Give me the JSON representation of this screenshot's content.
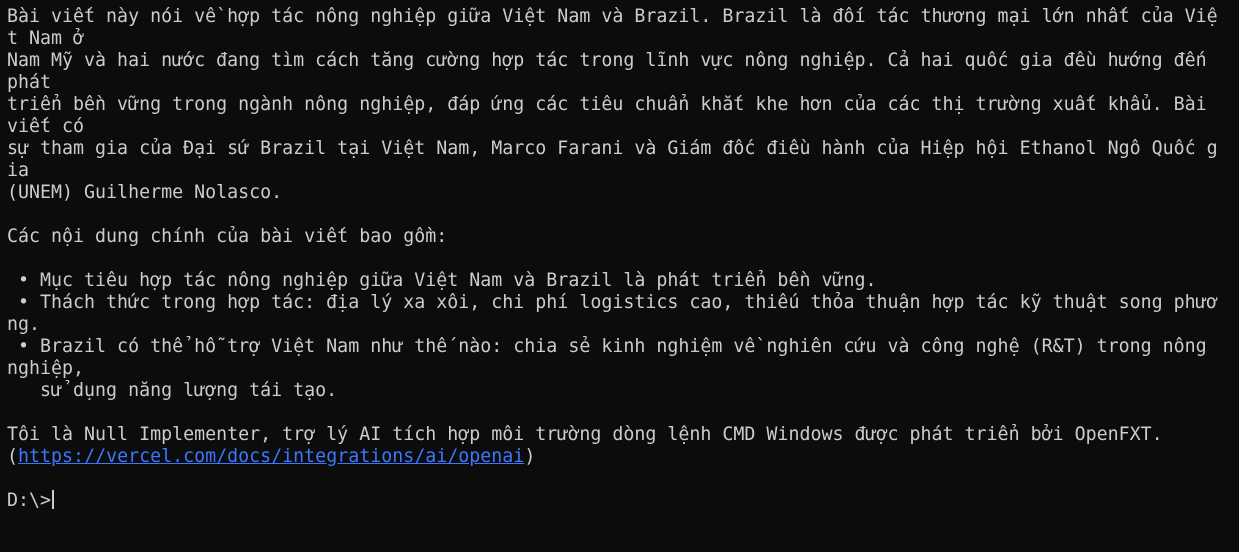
{
  "terminal": {
    "paragraph": [
      "Bài viết này nói về hợp tác nông nghiệp giữa Việt Nam và Brazil. Brazil là đối tác thương mại lớn nhất của Việ",
      "t Nam ở",
      "Nam Mỹ và hai nước đang tìm cách tăng cường hợp tác trong lĩnh vực nông nghiệp. Cả hai quốc gia đều hướng đến",
      "phát",
      "triển bền vững trong ngành nông nghiệp, đáp ứng các tiêu chuẩn khắt khe hơn của các thị trường xuất khẩu. Bài",
      "viết có",
      "sự tham gia của Đại sứ Brazil tại Việt Nam, Marco Farani và Giám đốc điều hành của Hiệp hội Ethanol Ngô Quốc g",
      "ia",
      "(UNEM) Guilherme Nolasco."
    ],
    "section_heading": "Các nội dung chính của bài viết bao gồm:",
    "bullets": [
      " • Mục tiêu hợp tác nông nghiệp giữa Việt Nam và Brazil là phát triển bền vững.",
      " • Thách thức trong hợp tác: địa lý xa xôi, chi phí logistics cao, thiếu thỏa thuận hợp tác kỹ thuật song phươ",
      "ng.",
      " • Brazil có thể hỗ trợ Việt Nam như thế nào: chia sẻ kinh nghiệm về nghiên cứu và công nghệ (R&T) trong nông",
      "nghiệp,",
      "   sử dụng năng lượng tái tạo."
    ],
    "about_text": "Tôi là Null Implementer, trợ lý AI tích hợp môi trường dòng lệnh CMD Windows được phát triển bởi OpenFXT.",
    "link_open": "(",
    "link_url": "https://vercel.com/docs/integrations/ai/openai",
    "link_close": ")",
    "prompt": "D:\\>"
  },
  "colors": {
    "background": "#0c0c0c",
    "text": "#cccccc",
    "link": "#3b78ff"
  }
}
